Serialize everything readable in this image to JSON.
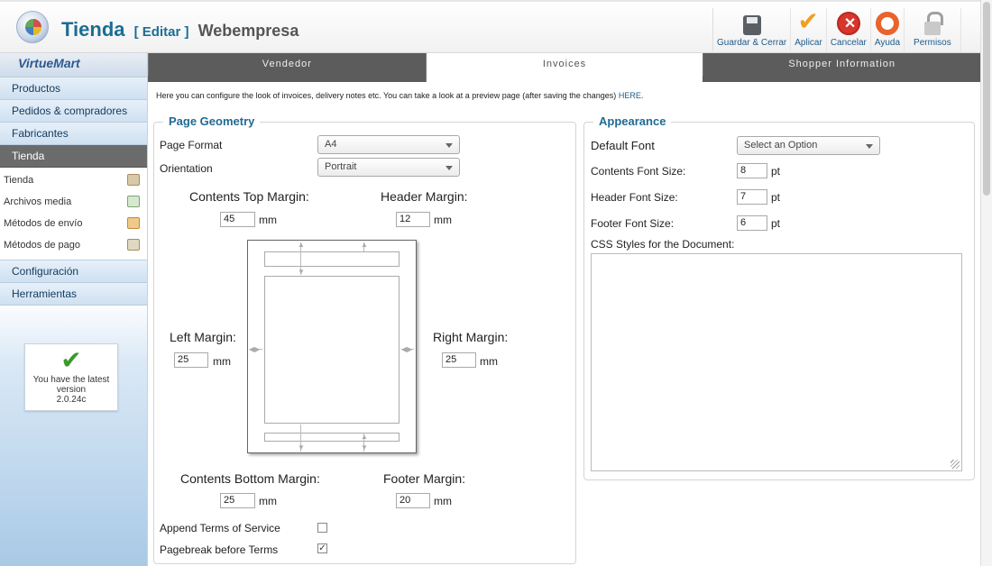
{
  "header": {
    "title": "Tienda",
    "edit_label": "[ Editar ]",
    "store_name": "Webempresa",
    "buttons": [
      {
        "label": "Guardar & Cerrar",
        "icon": "save-icon"
      },
      {
        "label": "Aplicar",
        "icon": "check-icon"
      },
      {
        "label": "Cancelar",
        "icon": "cancel-icon"
      },
      {
        "label": "Ayuda",
        "icon": "lifebuoy-icon"
      },
      {
        "label": "Permisos",
        "icon": "lock-icon"
      }
    ]
  },
  "sidebar": {
    "logo": "VirtueMart",
    "menu": [
      "Productos",
      "Pedidos & compradores",
      "Fabricantes",
      "Tienda"
    ],
    "sub_items": [
      "Tienda",
      "Archivos media",
      "Métodos de envío",
      "Métodos de pago"
    ],
    "bottom_menu": [
      "Configuración",
      "Herramientas"
    ],
    "version_box": {
      "line1": "You have the latest",
      "line2": "version",
      "line3": "2.0.24c"
    }
  },
  "tabs": [
    "Vendedor",
    "Invoices",
    "Shopper Information"
  ],
  "info": {
    "text": "Here you can configure the look of invoices, delivery notes etc. You can take a look at a preview page (after saving the changes)",
    "link": "HERE",
    "period": "."
  },
  "page_geometry": {
    "legend": "Page Geometry",
    "page_format_label": "Page Format",
    "page_format_value": "A4",
    "orientation_label": "Orientation",
    "orientation_value": "Portrait",
    "contents_top_label": "Contents Top Margin:",
    "contents_top_value": "45",
    "header_margin_label": "Header Margin:",
    "header_margin_value": "12",
    "left_margin_label": "Left Margin:",
    "left_margin_value": "25",
    "right_margin_label": "Right Margin:",
    "right_margin_value": "25",
    "contents_bottom_label": "Contents Bottom Margin:",
    "contents_bottom_value": "25",
    "footer_margin_label": "Footer Margin:",
    "footer_margin_value": "20",
    "unit_mm": "mm",
    "append_terms_label": "Append Terms of Service",
    "append_terms_checked": false,
    "pagebreak_label": "Pagebreak before Terms",
    "pagebreak_checked": true
  },
  "appearance": {
    "legend": "Appearance",
    "default_font_label": "Default Font",
    "default_font_value": "Select an Option",
    "contents_font_label": "Contents Font Size:",
    "contents_font_value": "8",
    "header_font_label": "Header Font Size:",
    "header_font_value": "7",
    "footer_font_label": "Footer Font Size:",
    "footer_font_value": "6",
    "unit_pt": "pt",
    "css_label": "CSS Styles for the Document:",
    "css_value": ""
  }
}
